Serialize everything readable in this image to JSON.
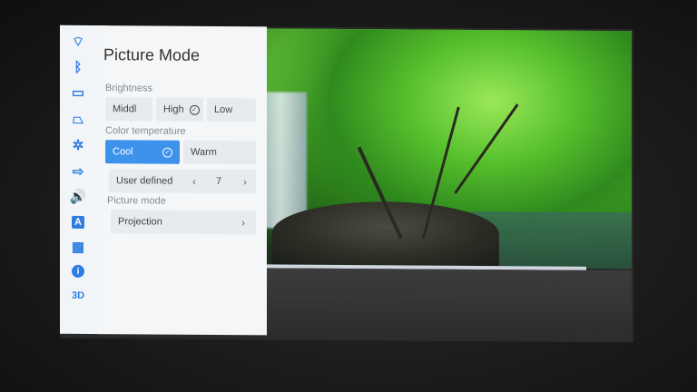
{
  "sidebar_icons": [
    {
      "name": "wifi-icon",
      "glyph": "⌔"
    },
    {
      "name": "bluetooth-icon",
      "glyph": "ᛒ"
    },
    {
      "name": "display-icon",
      "glyph": "▭"
    },
    {
      "name": "keystone-icon",
      "glyph": "⏢"
    },
    {
      "name": "settings-gear-icon",
      "glyph": "✲"
    },
    {
      "name": "input-source-icon",
      "glyph": "⇨"
    },
    {
      "name": "volume-icon",
      "glyph": "🔊"
    },
    {
      "name": "language-icon",
      "glyph": "A"
    },
    {
      "name": "apps-icon",
      "glyph": "▦"
    },
    {
      "name": "info-icon",
      "glyph": "i"
    },
    {
      "name": "3d-icon",
      "glyph": "3D"
    }
  ],
  "panel": {
    "title": "Picture Mode",
    "brightness": {
      "label": "Brightness",
      "options": [
        "Middl",
        "High",
        "Low"
      ],
      "selected": "High"
    },
    "color_temperature": {
      "label": "Color temperature",
      "options": [
        "Cool",
        "Warm"
      ],
      "selected": "Cool",
      "user_defined_label": "User defined",
      "user_defined_value": "7"
    },
    "picture_mode": {
      "label": "Picture mode",
      "value": "Projection"
    }
  },
  "colors": {
    "accent": "#3d93ec",
    "icon_blue": "#2f7de1"
  }
}
